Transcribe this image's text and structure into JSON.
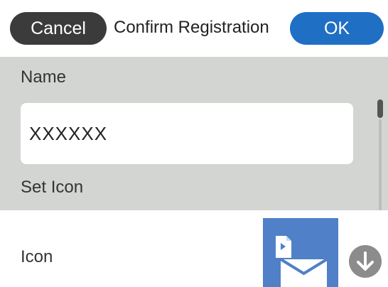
{
  "header": {
    "cancel_label": "Cancel",
    "title": "Confirm Registration",
    "ok_label": "OK"
  },
  "form": {
    "name_label": "Name",
    "name_value": "XXXXXX",
    "set_icon_label": "Set Icon",
    "icon_label": "Icon",
    "selected_icon": "document-to-email-icon"
  },
  "colors": {
    "ok_button": "#1f6fc4",
    "cancel_button": "#3b3b3b",
    "gray_panel": "#d3d5d3",
    "icon_tile": "#4f80c8"
  }
}
